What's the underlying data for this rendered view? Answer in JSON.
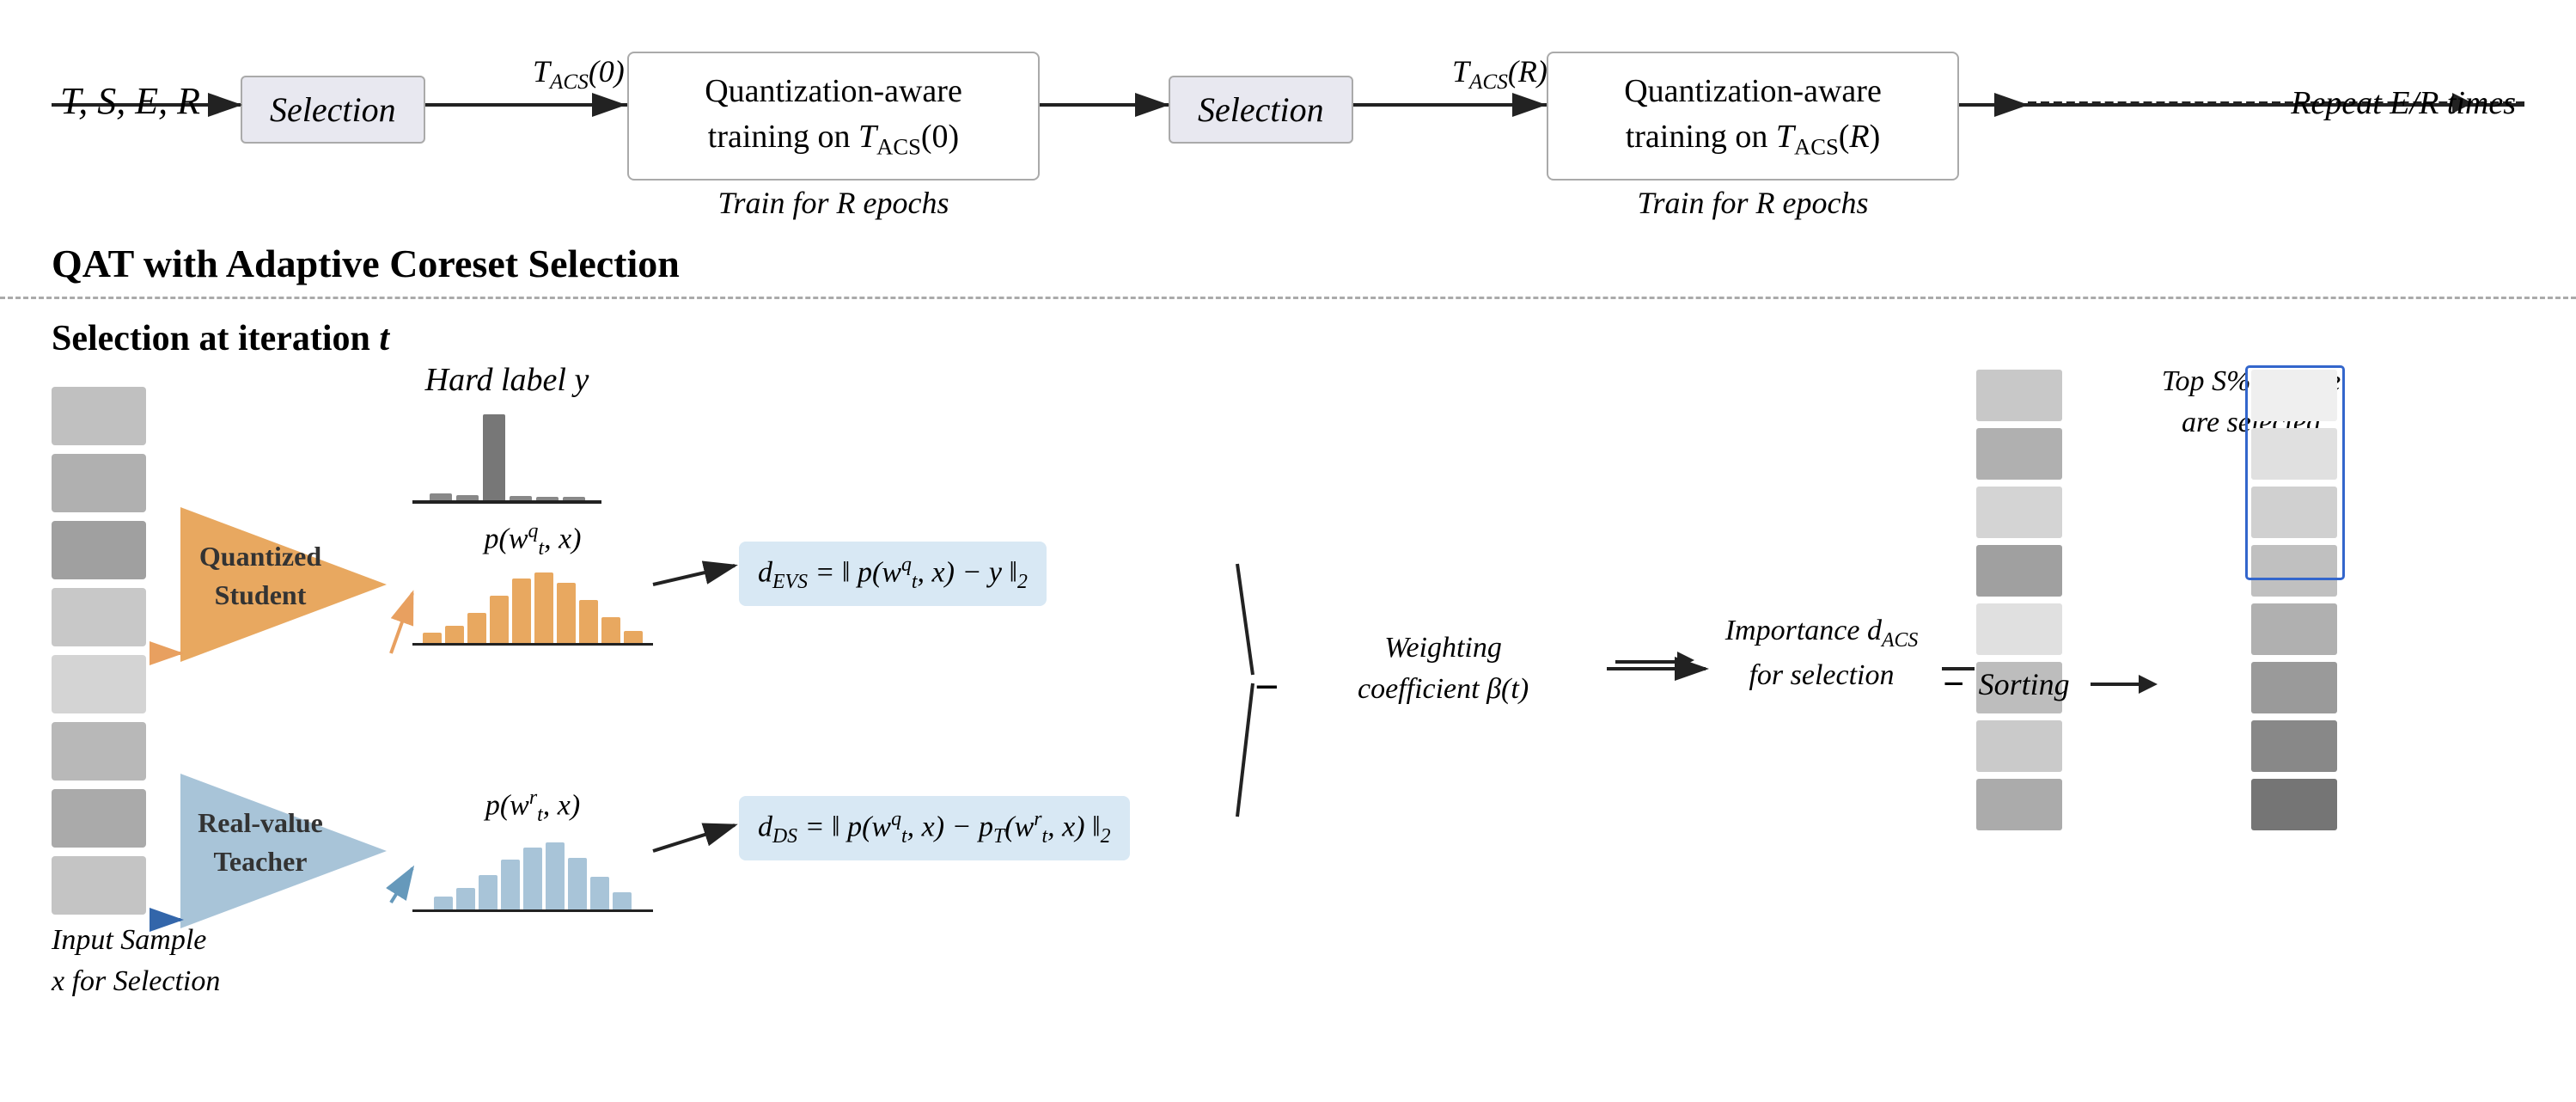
{
  "top_flow": {
    "tser_label": "T, S, E, R",
    "selection1_label": "Selection",
    "selection2_label": "Selection",
    "t_acs_0_label": "T_ACS(0)",
    "t_acs_r_label": "T_ACS(R)",
    "qat_box1_line1": "Quantization-aware",
    "qat_box1_line2": "training on T_ACS(0)",
    "qat_box2_line1": "Quantization-aware",
    "qat_box2_line2": "training on T_ACS(R)",
    "train_label1": "Train for R epochs",
    "train_label2": "Train for R epochs",
    "repeat_label": "Repeat E/R times"
  },
  "bottom": {
    "qat_title": "QAT with Adaptive Coreset Selection",
    "selection_iteration_title": "Selection at iteration t",
    "hard_label": "Hard label y",
    "student_label_line1": "Quantized",
    "student_label_line2": "Student",
    "teacher_label_line1": "Real-value",
    "teacher_label_line2": "Teacher",
    "dist_student_label": "p(w_t^q, x)",
    "dist_teacher_label": "p(w_t^r, x)",
    "formula_evs": "d_EVS = || p(w_t^q, x) − y ||₂",
    "formula_ds": "d_DS = || p(w_t^q, x) − p_T(w_t^r, x) ||₂",
    "weight_coeff": "Weighting coefficient β(t)",
    "importance_label": "Importance d_ACS for selection",
    "top_s_label": "Top S% sample are selected",
    "sorting_label": "Sorting",
    "input_sample_label": "Input Sample x for Selection"
  },
  "colors": {
    "orange_triangle": "#e8a860",
    "blue_triangle": "#a8c4d8",
    "formula_bg": "#d8e8f4",
    "selection_box_bg": "#e8e8f0",
    "blue_border": "#3366cc"
  }
}
